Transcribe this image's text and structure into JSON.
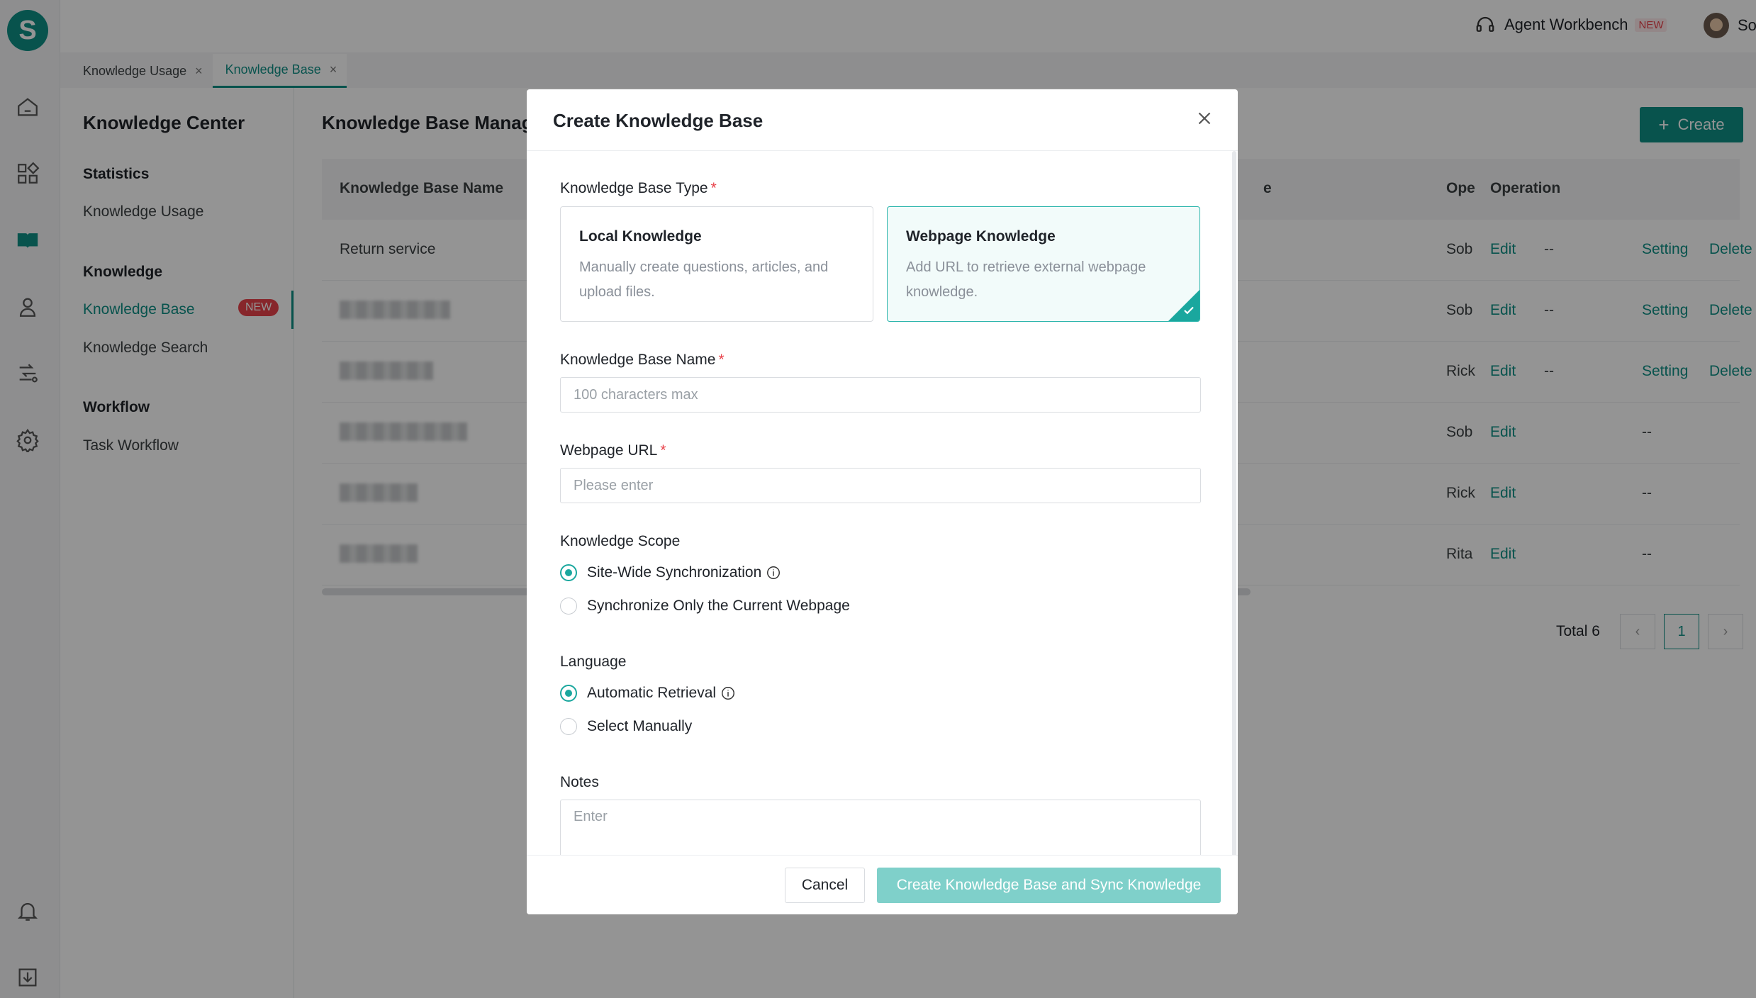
{
  "app": {
    "logo_letter": "S"
  },
  "rail": {
    "icons": [
      "home-icon",
      "apps-icon",
      "book-icon",
      "user-icon",
      "workflow-icon",
      "gear-icon",
      "bell-icon",
      "download-icon"
    ]
  },
  "topbar": {
    "agent_workbench": "Agent Workbench",
    "new_badge": "NEW",
    "user_name": "Sobot"
  },
  "tabs": [
    {
      "label": "Knowledge Usage",
      "active": false
    },
    {
      "label": "Knowledge Base",
      "active": true
    }
  ],
  "sidebar": {
    "title": "Knowledge Center",
    "groups": [
      {
        "heading": "Statistics",
        "items": [
          "Knowledge Usage"
        ]
      },
      {
        "heading": "Knowledge",
        "items": [
          "Knowledge Base",
          "Knowledge Search"
        ]
      },
      {
        "heading": "Workflow",
        "items": [
          "Task Workflow"
        ]
      }
    ],
    "new_badge": "NEW"
  },
  "main": {
    "title": "Knowledge Base Manage",
    "create_label": "Create",
    "columns": {
      "name": "Knowledge Base Name",
      "col_e": "e",
      "ope": "Ope",
      "operation": "Operation"
    },
    "rows": [
      {
        "name": "Return service",
        "ope": "Sob",
        "edit": "Edit",
        "dash": "--",
        "setting": "Setting",
        "delete": "Delete"
      },
      {
        "name": "",
        "ope": "Sob",
        "edit": "Edit",
        "dash": "--",
        "setting": "Setting",
        "delete": "Delete"
      },
      {
        "name": "",
        "ope": "Rick",
        "edit": "Edit",
        "dash": "--",
        "setting": "Setting",
        "delete": "Delete"
      },
      {
        "name": "",
        "ope": "Sob",
        "edit": "Edit",
        "dash": "--",
        "setting": "",
        "delete": ""
      },
      {
        "name": "",
        "ope": "Rick",
        "edit": "Edit",
        "dash": "--",
        "setting": "",
        "delete": ""
      },
      {
        "name": "",
        "ope": "Rita",
        "edit": "Edit",
        "dash": "--",
        "setting": "",
        "delete": ""
      }
    ],
    "pager": {
      "total": "Total 6",
      "current": "1",
      "prev": "‹",
      "next": "›"
    }
  },
  "modal": {
    "title": "Create Knowledge Base",
    "type_label": "Knowledge Base Type",
    "required_mark": "*",
    "cards": [
      {
        "title": "Local Knowledge",
        "desc": "Manually create questions, articles, and upload files.",
        "selected": false
      },
      {
        "title": "Webpage Knowledge",
        "desc": "Add URL to retrieve external webpage knowledge.",
        "selected": true
      }
    ],
    "name_label": "Knowledge Base Name",
    "name_placeholder": "100 characters max",
    "url_label": "Webpage URL",
    "url_placeholder": "Please enter",
    "scope_label": "Knowledge Scope",
    "scope_options": [
      "Site-Wide Synchronization",
      "Synchronize Only the Current Webpage"
    ],
    "language_label": "Language",
    "language_options": [
      "Automatic Retrieval",
      "Select Manually"
    ],
    "notes_label": "Notes",
    "notes_placeholder": "Enter",
    "cancel_label": "Cancel",
    "submit_label": "Create Knowledge Base and Sync Knowledge"
  },
  "colors": {
    "accent": "#0e8f86",
    "accent_light": "#7fd0ca",
    "danger": "#e8424a"
  }
}
